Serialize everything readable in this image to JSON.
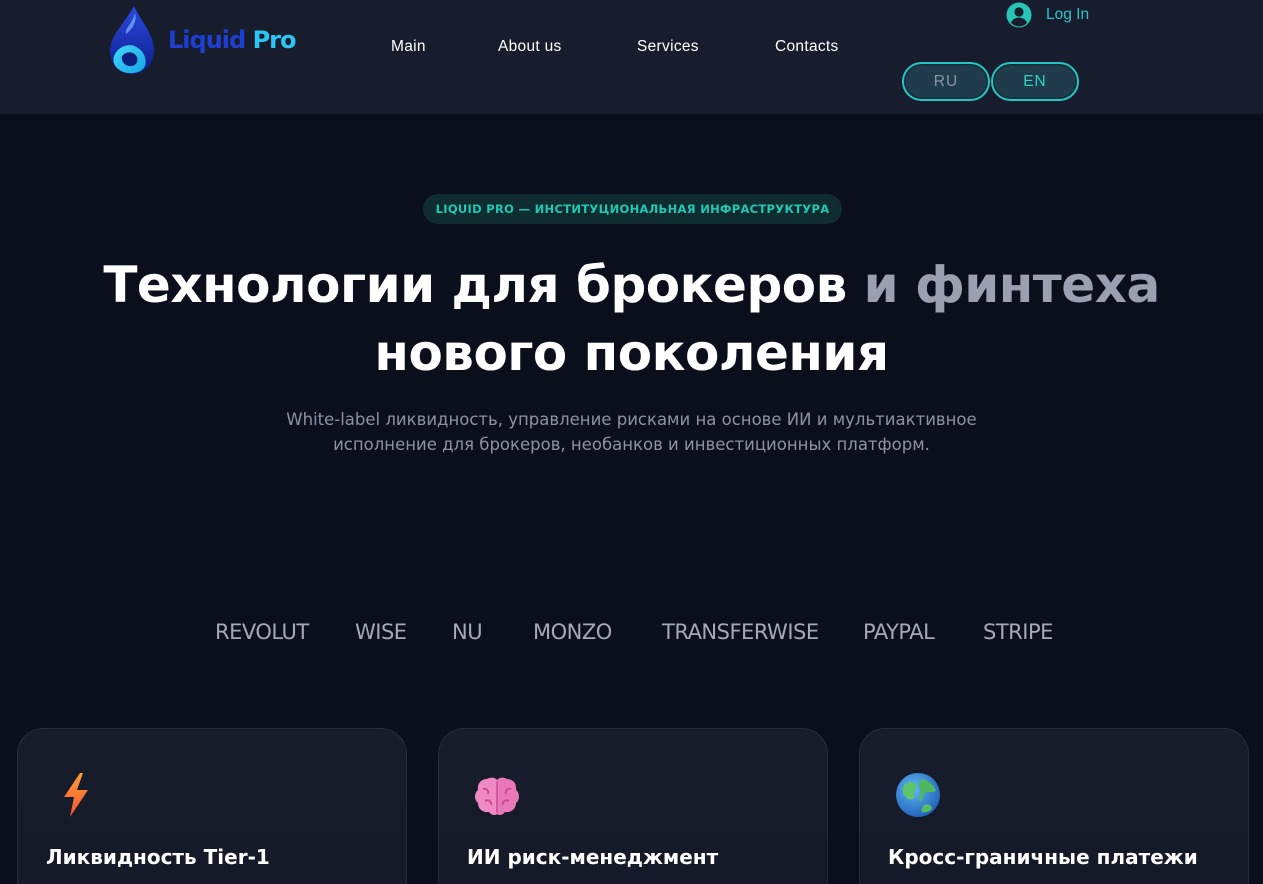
{
  "colors": {
    "background": "#0b0f1c",
    "header": "#181d2d",
    "accent": "#27c4c4",
    "badge_text": "#22c8b4"
  },
  "header": {
    "logo": {
      "word1": "Liquid",
      "word2": "Pro",
      "icon": "water-drop-icon"
    },
    "nav": [
      {
        "label": "Main"
      },
      {
        "label": "About us"
      },
      {
        "label": "Services"
      },
      {
        "label": "Contacts"
      }
    ],
    "login": {
      "label": "Log In",
      "icon": "user-circle-icon"
    },
    "languages": [
      {
        "code": "RU"
      },
      {
        "code": "EN",
        "selected": true
      }
    ]
  },
  "hero": {
    "badge": "LIQUID PRO — ИНСТИТУЦИОНАЛЬНАЯ ИНФРАСТРУКТУРА",
    "title_line1_main": "Технологии для брокеров",
    "title_line1_highlight": "и финтеха",
    "title_line2": "нового поколения",
    "subtitle_line1": "White-label ликвидность, управление рисками на основе ИИ и мультиактивное",
    "subtitle_line2": "исполнение для брокеров, необанков и инвестиционных платформ."
  },
  "partners": [
    "REVOLUT",
    "WISE",
    "NU",
    "MONZO",
    "TRANSFERWISE",
    "PAYPAL",
    "STRIPE"
  ],
  "features": [
    {
      "icon": "lightning-icon",
      "title": "Ликвидность Tier-1"
    },
    {
      "icon": "brain-icon",
      "title": "ИИ риск-менеджмент"
    },
    {
      "icon": "globe-icon",
      "title": "Кросс-граничные платежи"
    }
  ]
}
